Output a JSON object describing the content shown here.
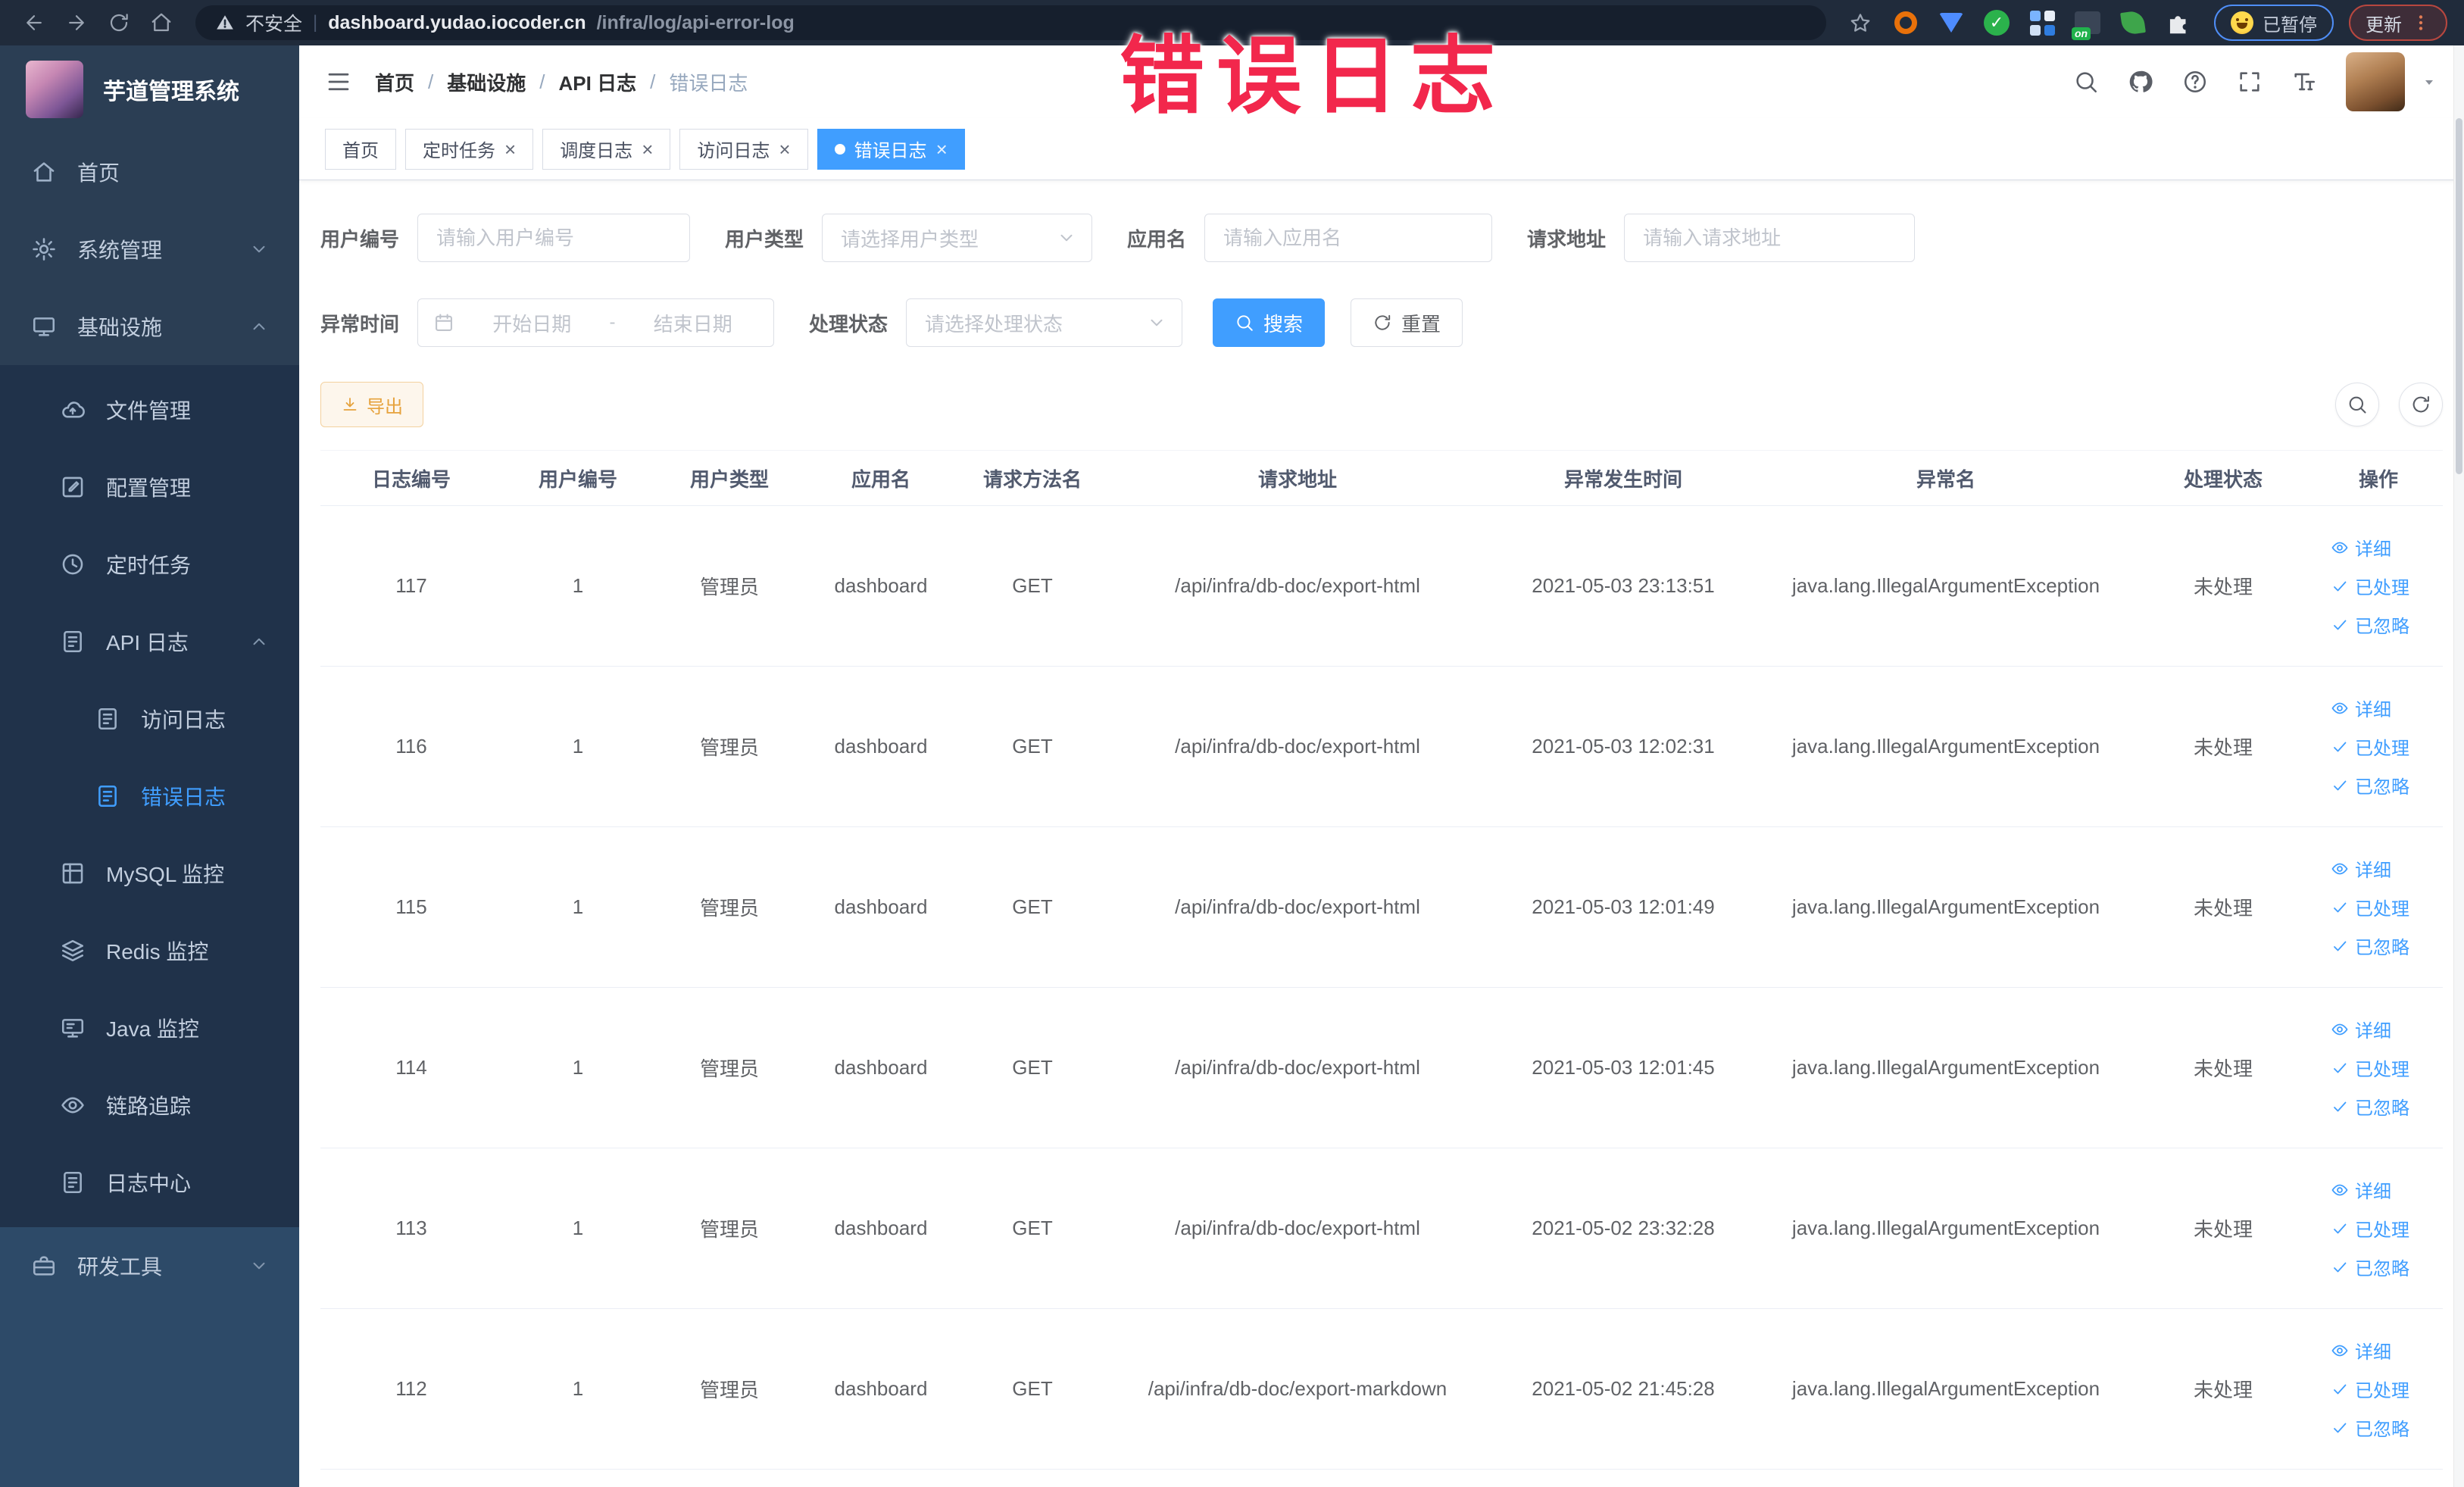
{
  "browser": {
    "security_label": "不安全",
    "url_host": "dashboard.yudao.iocoder.cn",
    "url_path": "/infra/log/api-error-log",
    "paused_badge": "已暂停",
    "update_badge": "更新"
  },
  "annotation": {
    "text": "错误日志",
    "color": "#f2274c"
  },
  "sidebar": {
    "logo_title": "芋道管理系统",
    "sections": {
      "top": [
        {
          "id": "home",
          "label": "首页",
          "icon": "home"
        },
        {
          "id": "system",
          "label": "系统管理",
          "icon": "gear",
          "chevron": "down"
        },
        {
          "id": "infra",
          "label": "基础设施",
          "icon": "monitor",
          "chevron": "up"
        }
      ],
      "submenu": [
        {
          "id": "file",
          "label": "文件管理",
          "icon": "cloud"
        },
        {
          "id": "config",
          "label": "配置管理",
          "icon": "editsq"
        },
        {
          "id": "job",
          "label": "定时任务",
          "icon": "clock"
        },
        {
          "id": "api-log",
          "label": "API 日志",
          "icon": "docedit",
          "chevron": "up"
        },
        {
          "id": "access-log",
          "label": "访问日志",
          "icon": "docedit",
          "level": 3
        },
        {
          "id": "error-log",
          "label": "错误日志",
          "icon": "docedit",
          "level": 3,
          "active": true
        },
        {
          "id": "mysql",
          "label": "MySQL 监控",
          "icon": "gridtbl"
        },
        {
          "id": "redis",
          "label": "Redis 监控",
          "icon": "layers"
        },
        {
          "id": "java",
          "label": "Java 监控",
          "icon": "javamon"
        },
        {
          "id": "trace",
          "label": "链路追踪",
          "icon": "eye"
        },
        {
          "id": "log-center",
          "label": "日志中心",
          "icon": "docedit"
        }
      ],
      "bottom": [
        {
          "id": "dev-tool",
          "label": "研发工具",
          "icon": "tool",
          "chevron": "down"
        }
      ]
    }
  },
  "header": {
    "breadcrumbs": [
      "首页",
      "基础设施",
      "API 日志",
      "错误日志"
    ]
  },
  "tabs": [
    {
      "label": "首页",
      "closable": false,
      "active": false
    },
    {
      "label": "定时任务",
      "closable": true,
      "active": false
    },
    {
      "label": "调度日志",
      "closable": true,
      "active": false
    },
    {
      "label": "访问日志",
      "closable": true,
      "active": false
    },
    {
      "label": "错误日志",
      "closable": true,
      "active": true
    }
  ],
  "filters": {
    "user_id": {
      "label": "用户编号",
      "placeholder": "请输入用户编号"
    },
    "user_type": {
      "label": "用户类型",
      "placeholder": "请选择用户类型"
    },
    "app_name": {
      "label": "应用名",
      "placeholder": "请输入应用名"
    },
    "request_url": {
      "label": "请求地址",
      "placeholder": "请输入请求地址"
    },
    "exception_time": {
      "label": "异常时间",
      "start_placeholder": "开始日期",
      "separator": "-",
      "end_placeholder": "结束日期"
    },
    "process_status": {
      "label": "处理状态",
      "placeholder": "请选择处理状态"
    },
    "search_label": "搜索",
    "reset_label": "重置"
  },
  "toolbar": {
    "export_label": "导出"
  },
  "table": {
    "columns": [
      "日志编号",
      "用户编号",
      "用户类型",
      "应用名",
      "请求方法名",
      "请求地址",
      "异常发生时间",
      "异常名",
      "处理状态",
      "操作"
    ],
    "actions": [
      {
        "label": "详细",
        "icon": "eye"
      },
      {
        "label": "已处理",
        "icon": "check"
      },
      {
        "label": "已忽略",
        "icon": "check"
      }
    ],
    "rows": [
      {
        "id": "117",
        "user_id": "1",
        "user_type": "管理员",
        "app": "dashboard",
        "method": "GET",
        "url": "/api/infra/db-doc/export-html",
        "time": "2021-05-03 23:13:51",
        "exception": "java.lang.IllegalArgumentException",
        "status": "未处理"
      },
      {
        "id": "116",
        "user_id": "1",
        "user_type": "管理员",
        "app": "dashboard",
        "method": "GET",
        "url": "/api/infra/db-doc/export-html",
        "time": "2021-05-03 12:02:31",
        "exception": "java.lang.IllegalArgumentException",
        "status": "未处理"
      },
      {
        "id": "115",
        "user_id": "1",
        "user_type": "管理员",
        "app": "dashboard",
        "method": "GET",
        "url": "/api/infra/db-doc/export-html",
        "time": "2021-05-03 12:01:49",
        "exception": "java.lang.IllegalArgumentException",
        "status": "未处理"
      },
      {
        "id": "114",
        "user_id": "1",
        "user_type": "管理员",
        "app": "dashboard",
        "method": "GET",
        "url": "/api/infra/db-doc/export-html",
        "time": "2021-05-03 12:01:45",
        "exception": "java.lang.IllegalArgumentException",
        "status": "未处理"
      },
      {
        "id": "113",
        "user_id": "1",
        "user_type": "管理员",
        "app": "dashboard",
        "method": "GET",
        "url": "/api/infra/db-doc/export-html",
        "time": "2021-05-02 23:32:28",
        "exception": "java.lang.IllegalArgumentException",
        "status": "未处理"
      },
      {
        "id": "112",
        "user_id": "1",
        "user_type": "管理员",
        "app": "dashboard",
        "method": "GET",
        "url": "/api/infra/db-doc/export-markdown",
        "time": "2021-05-02 21:45:28",
        "exception": "java.lang.IllegalArgumentException",
        "status": "未处理"
      }
    ]
  }
}
